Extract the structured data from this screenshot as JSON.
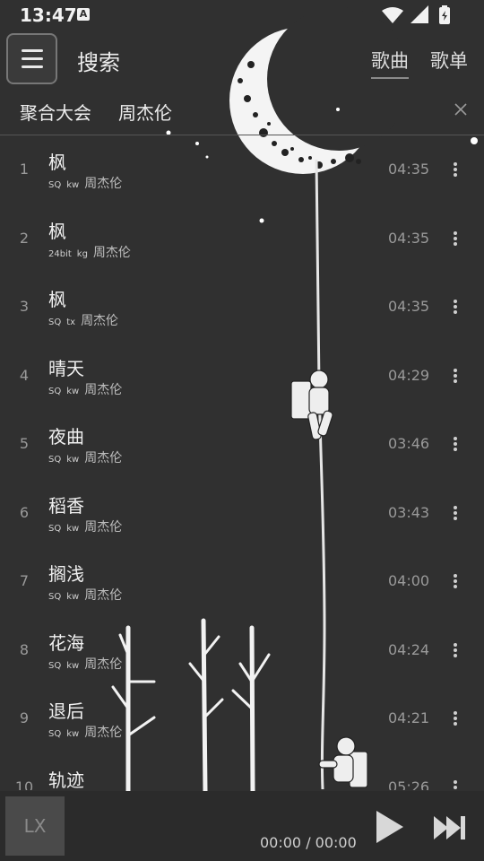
{
  "status_bar": {
    "time": "13:47",
    "a_badge": "A"
  },
  "header": {
    "title": "搜索",
    "tabs": [
      {
        "label": "歌曲",
        "active": true
      },
      {
        "label": "歌单",
        "active": false
      }
    ]
  },
  "query_bar": {
    "source": "聚合大会",
    "query": "周杰伦",
    "clear_symbol": "×"
  },
  "songs": [
    {
      "index": "1",
      "title": "枫",
      "quality": "SQ",
      "source": "kw",
      "artist": "周杰伦",
      "duration": "04:35"
    },
    {
      "index": "2",
      "title": "枫",
      "quality": "24bit",
      "source": "kg",
      "artist": "周杰伦",
      "duration": "04:35"
    },
    {
      "index": "3",
      "title": "枫",
      "quality": "SQ",
      "source": "tx",
      "artist": "周杰伦",
      "duration": "04:35"
    },
    {
      "index": "4",
      "title": "晴天",
      "quality": "SQ",
      "source": "kw",
      "artist": "周杰伦",
      "duration": "04:29"
    },
    {
      "index": "5",
      "title": "夜曲",
      "quality": "SQ",
      "source": "kw",
      "artist": "周杰伦",
      "duration": "03:46"
    },
    {
      "index": "6",
      "title": "稻香",
      "quality": "SQ",
      "source": "kw",
      "artist": "周杰伦",
      "duration": "03:43"
    },
    {
      "index": "7",
      "title": "搁浅",
      "quality": "SQ",
      "source": "kw",
      "artist": "周杰伦",
      "duration": "04:00"
    },
    {
      "index": "8",
      "title": "花海",
      "quality": "SQ",
      "source": "kw",
      "artist": "周杰伦",
      "duration": "04:24"
    },
    {
      "index": "9",
      "title": "退后",
      "quality": "SQ",
      "source": "kw",
      "artist": "周杰伦",
      "duration": "04:21"
    },
    {
      "index": "10",
      "title": "轨迹",
      "quality": "",
      "source": "",
      "artist": "",
      "duration": "05:26"
    }
  ],
  "player": {
    "cover_text": "LX",
    "time": "00:00 / 00:00"
  },
  "icons": {
    "menu": "hamburger-menu-icon",
    "clear": "close-icon",
    "more": "more-vert-icon",
    "play": "play-icon",
    "next": "skip-next-icon"
  },
  "colors": {
    "background": "#303030",
    "player_background": "#2b2b2b",
    "text": "#e8e8e8",
    "muted": "#9a9a9a"
  }
}
